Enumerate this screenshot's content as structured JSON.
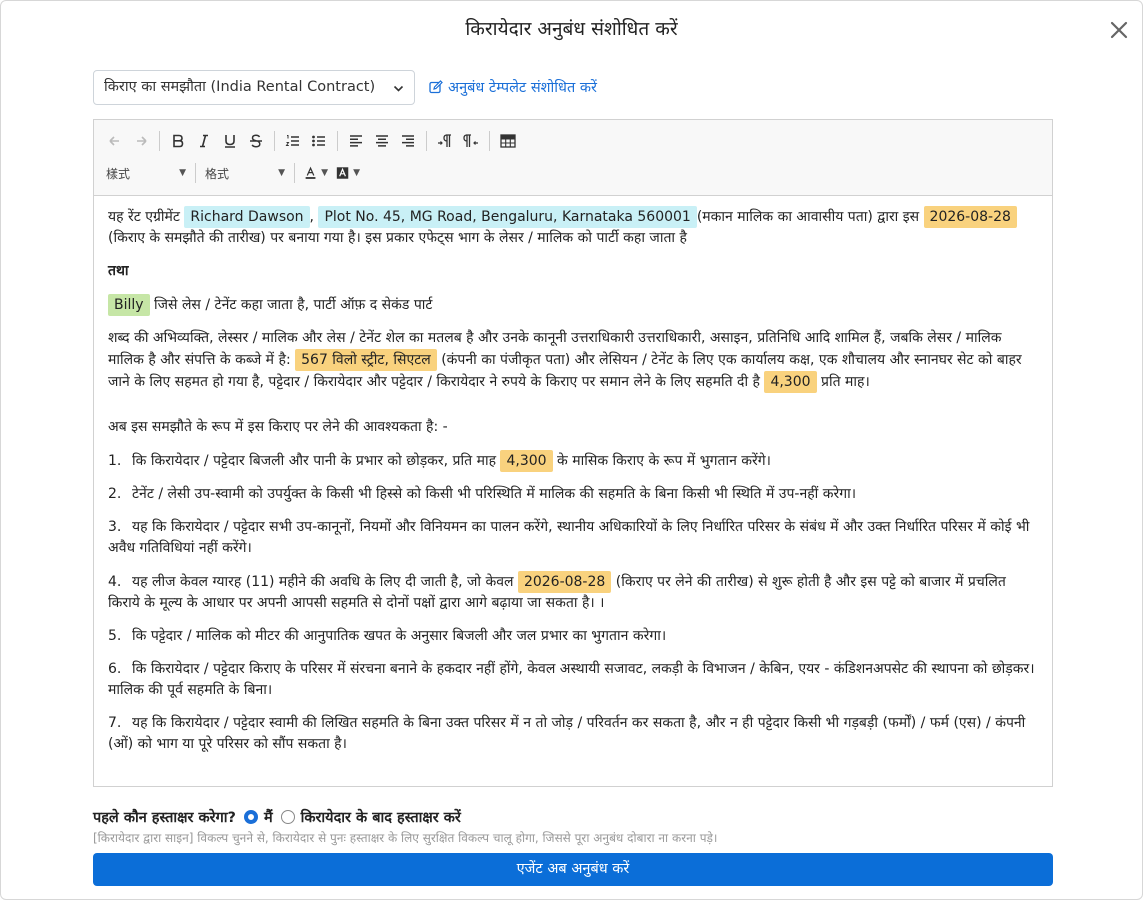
{
  "modal": {
    "title": "किरायेदार अनुबंध संशोधित करें"
  },
  "template": {
    "selected": "किराए का समझौता (India Rental Contract)",
    "edit_link": "अनुबंध टेम्पलेट संशोधित करें"
  },
  "toolbar": {
    "style_dropdown_1": "樣式",
    "style_dropdown_2": "格式"
  },
  "contract": {
    "p1": {
      "t1": "यह रेंट एग्रीमेंट",
      "landlord_name": "Richard Dawson",
      "t2": ",",
      "landlord_address": "Plot No. 45, MG Road, Bengaluru, Karnataka 560001",
      "t3": "(मकान मालिक का आवासीय पता) द्वारा इस",
      "contract_date": "2026-08-28",
      "t4": "(किराए के समझौते की तारीख) पर बनाया गया है। इस प्रकार एफेट्स भाग के लेसर / मालिक को पार्टी कहा जाता है"
    },
    "and": "तथा",
    "p2": {
      "tenant_name": "Billy",
      "t1": "जिसे लेस / टेनेंट कहा जाता है, पार्टी ऑफ़ द सेकंड पार्ट"
    },
    "p3": {
      "t1": "शब्द की अभिव्यक्ति, लेस्सर / मालिक और लेस / टेनेंट शेल का मतलब है और उनके कानूनी उत्तराधिकारी उत्तराधिकारी, असाइन, प्रतिनिधि आदि शामिल हैं, जबकि लेसर / मालिक मालिक है और संपत्ति के कब्जे में है:",
      "property_address": "567 विलो स्ट्रीट, सिएटल",
      "t2": "(कंपनी का पंजीकृत पता) और लेसियन / टेनेंट के लिए एक कार्यालय कक्ष, एक शौचालय और स्नानघर सेट को बाहर जाने के लिए सहमत हो गया है, पट्टेदार / किरायेदार और पट्टेदार / किरायेदार ने रुपये के किराए पर समान लेने के लिए सहमति दी है",
      "rent": "4,300",
      "t3": "प्रति माह।"
    },
    "intro": "अब इस समझौते के रूप में इस किराए पर लेने की आवश्यकता है: -",
    "c1": {
      "num": "1.",
      "t1": "कि किरायेदार / पट्टेदार बिजली और पानी के प्रभार को छोड़कर, प्रति माह",
      "rent": "4,300",
      "t2": "के मासिक किराए के रूप में भुगतान करेंगे।"
    },
    "c2": {
      "num": "2.",
      "text": "टेनेंट / लेसी उप-स्वामी को उपर्युक्त के किसी भी हिस्से को किसी भी परिस्थिति में मालिक की सहमति के बिना किसी भी स्थिति में उप-नहीं करेगा।"
    },
    "c3": {
      "num": "3.",
      "text": "यह कि किरायेदार / पट्टेदार सभी उप-कानूनों, नियमों और विनियमन का पालन करेंगे, स्थानीय अधिकारियों के लिए निर्धारित परिसर के संबंध में और उक्त निर्धारित परिसर में कोई भी अवैध गतिविधियां नहीं करेंगे।"
    },
    "c4": {
      "num": "4.",
      "t1": "यह लीज केवल ग्यारह (11) महीने की अवधि के लिए दी जाती है, जो केवल",
      "start_date": "2026-08-28",
      "t2": "(किराए पर लेने की तारीख) से शुरू होती है और इस पट्टे को बाजार में प्रचलित किराये के मूल्य के आधार पर अपनी आपसी सहमति से दोनों पक्षों द्वारा आगे बढ़ाया जा सकता है। ।"
    },
    "c5": {
      "num": "5.",
      "text": "कि पट्टेदार / मालिक को मीटर की आनुपातिक खपत के अनुसार बिजली और जल प्रभार का भुगतान करेगा।"
    },
    "c6": {
      "num": "6.",
      "text": "कि किरायेदार / पट्टेदार किराए के परिसर में संरचना बनाने के हकदार नहीं होंगे, केवल अस्थायी सजावट, लकड़ी के विभाजन / केबिन, एयर - कंडिशनअपसेट की स्थापना को छोड़कर। मालिक की पूर्व सहमति के बिना।"
    },
    "c7": {
      "num": "7.",
      "text": "यह कि किरायेदार / पट्टेदार स्वामी की लिखित सहमति के बिना उक्त परिसर में न तो जोड़ / परिवर्तन कर सकता है, और न ही पट्टेदार किसी भी गड़बड़ी (फर्मों) / फर्म (एस) / कंपनी (ओं) को भाग या पूरे परिसर को सौंप सकता है।"
    }
  },
  "signing": {
    "question": "पहले कौन हस्ताक्षर करेगा?",
    "option_me": "मैं",
    "option_after": "किरायेदार के बाद हस्ताक्षर करें",
    "selected": "मैं",
    "note": "[किरायेदार द्वारा साइन] विकल्प चुनने से, किरायेदार से पुनः हस्ताक्षर के लिए सुरक्षित विकल्प चालू होगा, जिससे पूरा अनुबंध दोबारा ना करना पड़े।"
  },
  "submit": {
    "label": "एजेंट अब अनुबंध करें"
  },
  "colors": {
    "primary": "#0b6ed8",
    "tag_cyan": "#c9f0f6",
    "tag_orange": "#f9d27e",
    "tag_green": "#c6e6a6"
  }
}
